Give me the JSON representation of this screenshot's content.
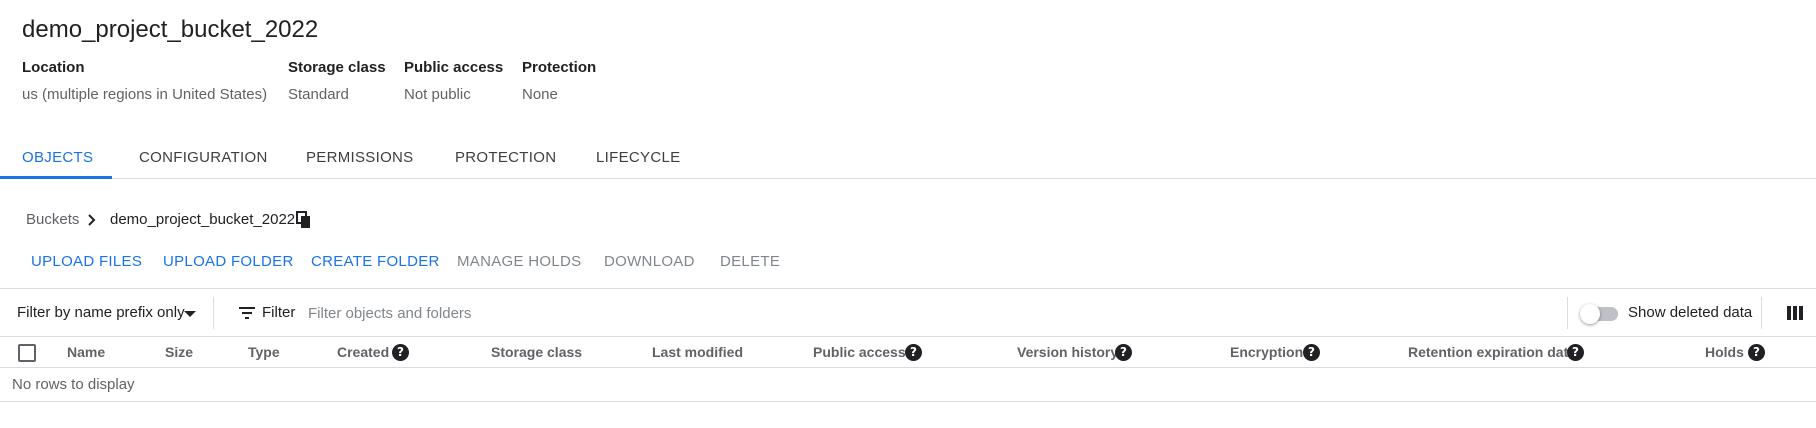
{
  "bucket": {
    "title": "demo_project_bucket_2022"
  },
  "meta": {
    "location": {
      "label": "Location",
      "value": "us (multiple regions in United States)"
    },
    "storage_class": {
      "label": "Storage class",
      "value": "Standard"
    },
    "public_access": {
      "label": "Public access",
      "value": "Not public"
    },
    "protection": {
      "label": "Protection",
      "value": "None"
    }
  },
  "tabs": [
    {
      "label": "OBJECTS",
      "active": true
    },
    {
      "label": "CONFIGURATION"
    },
    {
      "label": "PERMISSIONS"
    },
    {
      "label": "PROTECTION"
    },
    {
      "label": "LIFECYCLE"
    }
  ],
  "breadcrumb": {
    "root": "Buckets",
    "current": "demo_project_bucket_2022"
  },
  "actions": [
    {
      "label": "UPLOAD FILES",
      "enabled": true
    },
    {
      "label": "UPLOAD FOLDER",
      "enabled": true
    },
    {
      "label": "CREATE FOLDER",
      "enabled": true
    },
    {
      "label": "MANAGE HOLDS",
      "enabled": false
    },
    {
      "label": "DOWNLOAD",
      "enabled": false
    },
    {
      "label": "DELETE",
      "enabled": false
    }
  ],
  "filter_bar": {
    "prefix_select": "Filter by name prefix only",
    "filter_label": "Filter",
    "placeholder": "Filter objects and folders",
    "toggle_label": "Show deleted data",
    "toggle_on": false
  },
  "table": {
    "columns": [
      {
        "label": "Name"
      },
      {
        "label": "Size"
      },
      {
        "label": "Type"
      },
      {
        "label": "Created",
        "help": true
      },
      {
        "label": "Storage class"
      },
      {
        "label": "Last modified"
      },
      {
        "label": "Public access",
        "help": true
      },
      {
        "label": "Version history",
        "help": true
      },
      {
        "label": "Encryption",
        "help": true
      },
      {
        "label": "Retention expiration date",
        "help": true
      },
      {
        "label": "Holds",
        "help": true
      }
    ],
    "empty_text": "No rows to display"
  },
  "colors": {
    "accent": "#1a73e8",
    "disabled": "#80868b",
    "divider": "#dadce0"
  },
  "icons": {
    "breadcrumb_separator": "chevron-right-icon",
    "copy": "copy-icon",
    "filter": "filter-list-icon",
    "columns": "column-display-icon",
    "help": "help-icon"
  }
}
